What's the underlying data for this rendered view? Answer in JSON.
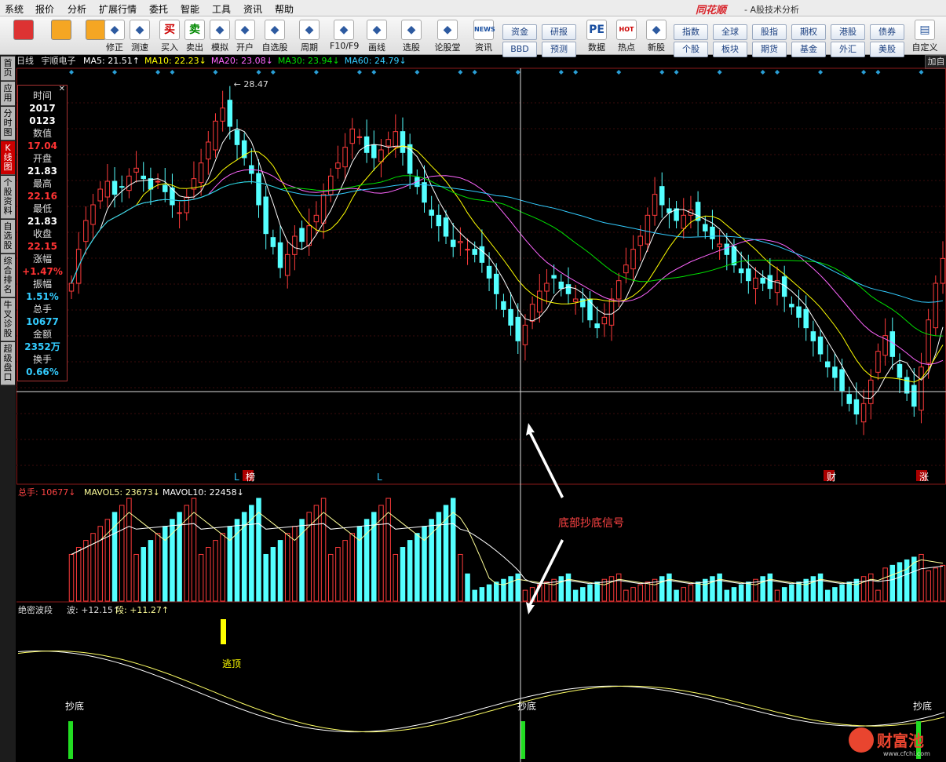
{
  "menu": [
    "系统",
    "报价",
    "分析",
    "扩展行情",
    "委托",
    "智能",
    "工具",
    "资讯",
    "帮助"
  ],
  "brand": {
    "name": "同花顺",
    "subtitle": "- A股技术分析"
  },
  "toolbar": {
    "buttons": [
      {
        "label": "修正",
        "icon": "up-down-arrows"
      },
      {
        "label": "测速",
        "icon": "speed-icon"
      },
      {
        "label": "买入",
        "icon": "buy-icon",
        "glyph": "买"
      },
      {
        "label": "卖出",
        "icon": "sell-icon",
        "glyph": "卖"
      },
      {
        "label": "模拟",
        "icon": "hammer-icon"
      },
      {
        "label": "开户",
        "icon": "lock-icon"
      },
      {
        "label": "自选股",
        "icon": "star-icon"
      },
      {
        "label": "周期",
        "icon": "clock-icon"
      },
      {
        "label": "F10/F9",
        "icon": "f10-icon"
      },
      {
        "label": "画线",
        "icon": "pen-icon"
      },
      {
        "label": "选股",
        "icon": "monitor-icon"
      },
      {
        "label": "论股堂",
        "icon": "forum-icon"
      },
      {
        "label": "资讯",
        "icon": "news-icon",
        "glyph": "NEWS"
      },
      {
        "label": "数据",
        "icon": "pe-icon",
        "glyph": "PE"
      },
      {
        "label": "热点",
        "icon": "hot-icon",
        "glyph": "HOT"
      },
      {
        "label": "新股",
        "icon": "new-stock-icon"
      }
    ],
    "quick": [
      "资金",
      "研报",
      "BBD",
      "预测",
      "指数",
      "全球",
      "股指",
      "期权",
      "港股",
      "债券",
      "个股",
      "板块",
      "期货",
      "基金",
      "外汇",
      "美股"
    ],
    "custom_label": "自定义"
  },
  "side_tabs": [
    "首页",
    "应用",
    "分时图",
    "K线图",
    "个股资料",
    "自选股",
    "综合排名",
    "牛叉诊股",
    "超级盘口"
  ],
  "main": {
    "period": "日线",
    "stock": "宇顺电子",
    "ma": [
      {
        "label": "MA5: 21.51",
        "color": "#ffffff",
        "arrow": "up"
      },
      {
        "label": "MA10: 22.23",
        "color": "#ffff00",
        "arrow": "down"
      },
      {
        "label": "MA20: 23.08",
        "color": "#ff66ff",
        "arrow": "down"
      },
      {
        "label": "MA30: 23.94",
        "color": "#00e000",
        "arrow": "down"
      },
      {
        "label": "MA60: 24.79",
        "color": "#33ccff",
        "arrow": "down"
      }
    ],
    "right_btn": "加自",
    "high_label": "28.47",
    "signals": [
      {
        "text": "L"
      },
      {
        "text": "榜"
      },
      {
        "text": "L"
      },
      {
        "text": "财"
      },
      {
        "text": "涨"
      }
    ]
  },
  "data_window": [
    {
      "k": "时间",
      "v": "2017",
      "v2": "0123",
      "c": "#ffffff"
    },
    {
      "k": "数值",
      "v": "17.04",
      "c": "#ff3333"
    },
    {
      "k": "开盘",
      "v": "21.83",
      "c": "#ffffff"
    },
    {
      "k": "最高",
      "v": "22.16",
      "c": "#ff3333"
    },
    {
      "k": "最低",
      "v": "21.83",
      "c": "#ffffff"
    },
    {
      "k": "收盘",
      "v": "22.15",
      "c": "#ff3333"
    },
    {
      "k": "涨幅",
      "v": "+1.47%",
      "c": "#ff3333"
    },
    {
      "k": "振幅",
      "v": "1.51%",
      "c": "#33ccff"
    },
    {
      "k": "总手",
      "v": "10677",
      "c": "#33ccff"
    },
    {
      "k": "金额",
      "v": "2352万",
      "c": "#33ccff"
    },
    {
      "k": "换手",
      "v": "0.66%",
      "c": "#33ccff"
    }
  ],
  "volume": {
    "label": "总手: 10677",
    "mavol5": "MAVOL5: 23673",
    "mavol10": "MAVOL10: 22458"
  },
  "wave": {
    "name": "绝密波段",
    "bo": "波: +12.15",
    "duan": "段: +11.27",
    "labels": {
      "bottom": "抄底",
      "top": "逃顶"
    }
  },
  "annotation": "底部抄底信号",
  "watermark": {
    "name": "财富池",
    "url": "www.cfchi.com"
  },
  "chart_data": {
    "type": "candlestick",
    "price_range": [
      15.5,
      29
    ],
    "closes": [
      21.2,
      22.5,
      23.6,
      24.2,
      24.8,
      25.1,
      24.6,
      24.9,
      25.3,
      25.6,
      25.2,
      24.8,
      25.1,
      24.7,
      24.2,
      23.9,
      24.5,
      25.2,
      25.8,
      26.6,
      27.4,
      27.9,
      27.2,
      26.5,
      26.0,
      25.4,
      24.2,
      23.1,
      22.6,
      21.8,
      22.3,
      23.0,
      22.8,
      23.4,
      23.8,
      24.6,
      25.3,
      25.8,
      26.4,
      27.1,
      26.8,
      26.2,
      26.0,
      26.3,
      26.7,
      27.0,
      26.2,
      25.4,
      24.9,
      24.3,
      23.8,
      23.4,
      23.0,
      22.6,
      22.8,
      22.5,
      22.3,
      22.0,
      21.4,
      20.8,
      20.2,
      19.6,
      19.0,
      19.6,
      20.4,
      20.9,
      21.2,
      21.4,
      21.0,
      20.8,
      20.6,
      20.3,
      19.8,
      19.5,
      19.9,
      20.6,
      21.3,
      21.9,
      22.5,
      23.0,
      23.8,
      24.6,
      24.2,
      23.9,
      23.6,
      23.8,
      24.0,
      23.6,
      23.2,
      22.9,
      22.7,
      22.3,
      21.9,
      21.6,
      21.3,
      21.4,
      21.2,
      21.0,
      21.3,
      20.7,
      20.3,
      19.9,
      19.5,
      19.0,
      18.5,
      18.0,
      17.6,
      17.1,
      16.6,
      16.2,
      16.6,
      17.5,
      18.6,
      19.2,
      18.4,
      17.6,
      17.0,
      16.5,
      18.0,
      19.8,
      21.2,
      22.15
    ],
    "volume_range": [
      0,
      130000
    ]
  }
}
